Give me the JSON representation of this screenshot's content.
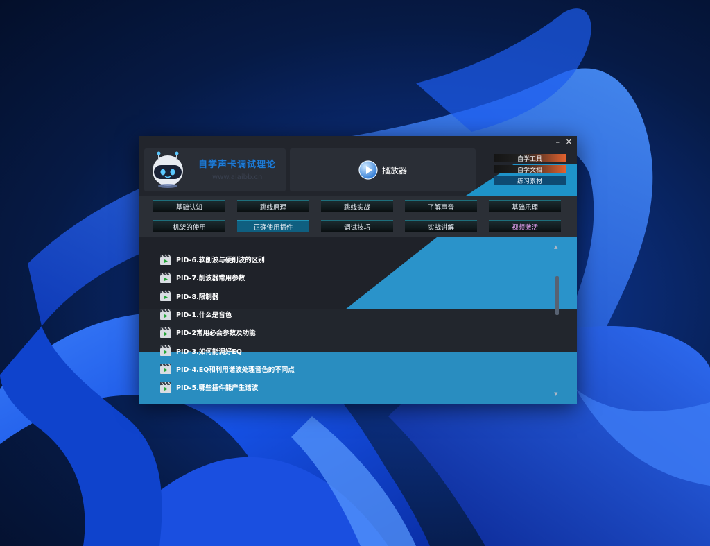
{
  "header": {
    "brand_title": "自学声卡调试理论",
    "brand_url": "www.aiaibb.cn",
    "player_label": "播放器",
    "tools": [
      "自学工具",
      "自学文档",
      "练习素材"
    ]
  },
  "window_controls": {
    "minimize": "–",
    "close": "✕"
  },
  "nav": {
    "row1": [
      "基础认知",
      "跳线原理",
      "跳线实战",
      "了解声音",
      "基础乐理"
    ],
    "row2": [
      "机架的使用",
      "正确使用插件",
      "调试技巧",
      "实战讲解",
      "视频激活"
    ],
    "active": "正确使用插件"
  },
  "list_items": [
    "PID-6.软削波与硬削波的区别",
    "PID-7.削波器常用参数",
    "PID-8.限制器",
    "PID-1.什么是音色",
    "PID-2常用必会参数及功能",
    "PID-3.如何能调好EQ",
    "PID-4.EQ和利用谐波处理音色的不同点",
    "PID-5.哪些插件能产生谐波"
  ],
  "colors": {
    "accent_blue": "#1e93c9",
    "accent_orange": "#e2622e",
    "brand_blue": "#1e7bd6",
    "activate_purple": "#e4a0f0"
  },
  "icons": [
    "robot-logo-icon",
    "play-circle-icon",
    "clapperboard-icon"
  ]
}
